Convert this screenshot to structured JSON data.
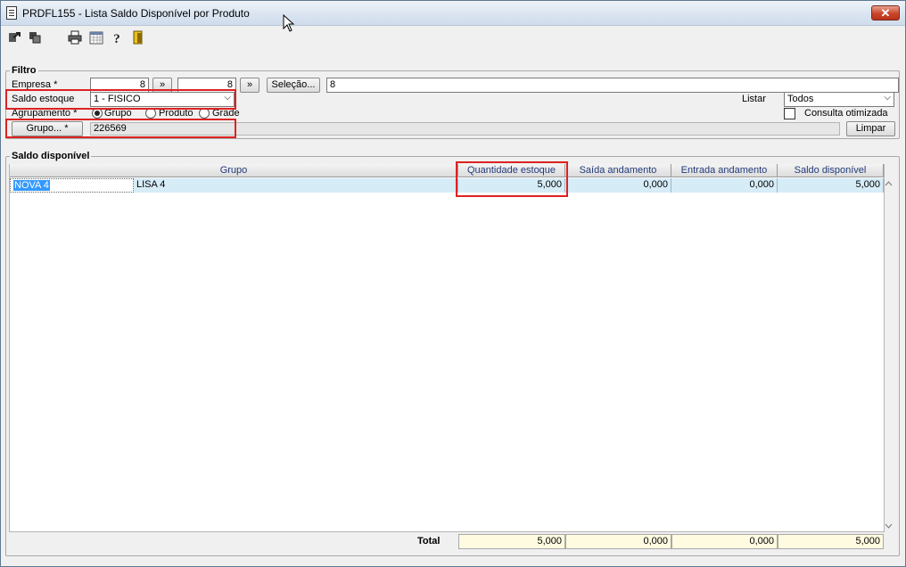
{
  "window": {
    "title": "PRDFL155 - Lista Saldo Disponível por Produto",
    "close_label": "✕"
  },
  "toolbar": {
    "icons": [
      "exit-icon",
      "copy-icon",
      "print-icon",
      "calendar-icon",
      "help-icon",
      "door-icon"
    ]
  },
  "filtro": {
    "legend": "Filtro",
    "empresa_label": "Empresa *",
    "empresa_from": "8",
    "empresa_to": "8",
    "arrow_label": "»",
    "selecao_label": "Seleção...",
    "selecao_value": "8",
    "saldo_estoque_label": "Saldo estoque",
    "saldo_estoque_value": "1 - FISICO",
    "agrupamento_label": "Agrupamento *",
    "agrupamento_options": [
      "Grupo",
      "Produto",
      "Grade"
    ],
    "agrupamento_selected": "Grupo",
    "listar_label": "Listar",
    "listar_value": "Todos",
    "consulta_otimizada_label": "Consulta otimizada",
    "consulta_otimizada_checked": false,
    "grupo_button_label": "Grupo... *",
    "grupo_value": "226569",
    "limpar_label": "Limpar"
  },
  "saldo": {
    "legend": "Saldo disponível",
    "columns": [
      "Grupo",
      "Quantidade estoque",
      "Saída andamento",
      "Entrada andamento",
      "Saldo disponível"
    ],
    "rows": [
      {
        "code": "NOVA 4",
        "name": "LISA 4",
        "quantidade": "5,000",
        "saida": "0,000",
        "entrada": "0,000",
        "saldo": "5,000"
      }
    ],
    "total_label": "Total",
    "totals": {
      "quantidade": "5,000",
      "saida": "0,000",
      "entrada": "0,000",
      "saldo": "5,000"
    }
  },
  "colors": {
    "row_selected": "#d6ecf7",
    "highlight_border": "#d22222",
    "total_bg": "#fffbe0",
    "header_text": "#223a7a"
  }
}
